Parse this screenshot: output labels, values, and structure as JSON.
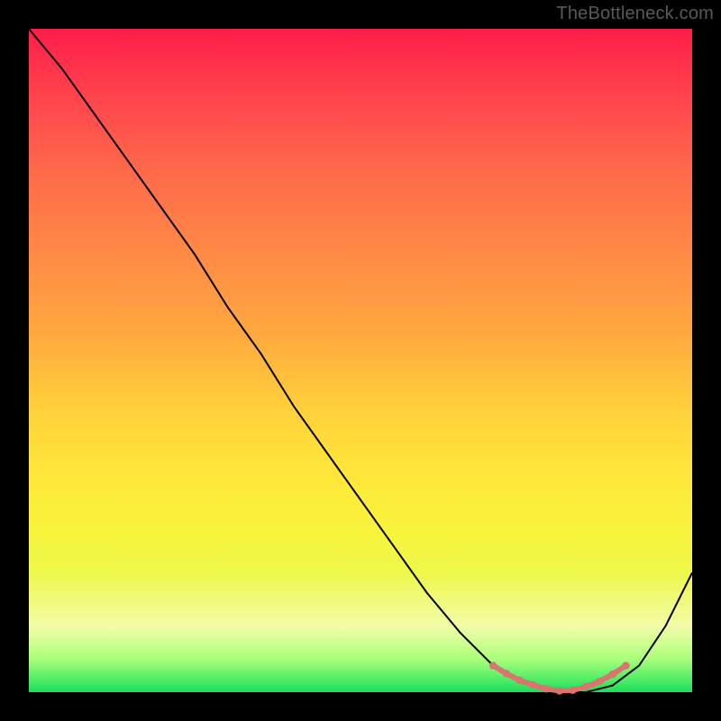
{
  "watermark": "TheBottleneck.com",
  "chart_data": {
    "type": "line",
    "title": "",
    "xlabel": "",
    "ylabel": "",
    "xlim": [
      0,
      100
    ],
    "ylim": [
      0,
      100
    ],
    "background_gradient": {
      "direction": "vertical",
      "stops": [
        {
          "pos": 0.0,
          "color": "#ff1e4a"
        },
        {
          "pos": 0.12,
          "color": "#ff4a4d"
        },
        {
          "pos": 0.22,
          "color": "#ff6b4a"
        },
        {
          "pos": 0.34,
          "color": "#ff8a45"
        },
        {
          "pos": 0.46,
          "color": "#ffa93f"
        },
        {
          "pos": 0.58,
          "color": "#ffd23a"
        },
        {
          "pos": 0.68,
          "color": "#ffe83a"
        },
        {
          "pos": 0.76,
          "color": "#f7f43c"
        },
        {
          "pos": 0.82,
          "color": "#eef84a"
        },
        {
          "pos": 0.9,
          "color": "#f2fca8"
        },
        {
          "pos": 0.95,
          "color": "#aaff7a"
        },
        {
          "pos": 1.0,
          "color": "#18e05a"
        }
      ]
    },
    "series": [
      {
        "name": "curve",
        "color": "#000000",
        "stroke_width": 2,
        "x": [
          0,
          5,
          10,
          15,
          20,
          25,
          30,
          35,
          40,
          45,
          50,
          55,
          60,
          65,
          70,
          73,
          76,
          80,
          84,
          88,
          92,
          96,
          100
        ],
        "y": [
          100,
          94,
          87,
          80,
          73,
          66,
          58,
          51,
          43,
          36,
          29,
          22,
          15,
          9,
          4,
          2,
          1,
          0,
          0,
          1,
          4,
          10,
          18
        ]
      }
    ],
    "highlight": {
      "name": "valley-points",
      "color": "#d9746f",
      "marker_radius": 4.2,
      "stroke_width": 6,
      "x": [
        70,
        72,
        74,
        76,
        78,
        80,
        82,
        84,
        86,
        88,
        90
      ],
      "y": [
        4,
        2.8,
        1.8,
        1.1,
        0.5,
        0.2,
        0.3,
        0.8,
        1.6,
        2.7,
        4
      ]
    }
  }
}
